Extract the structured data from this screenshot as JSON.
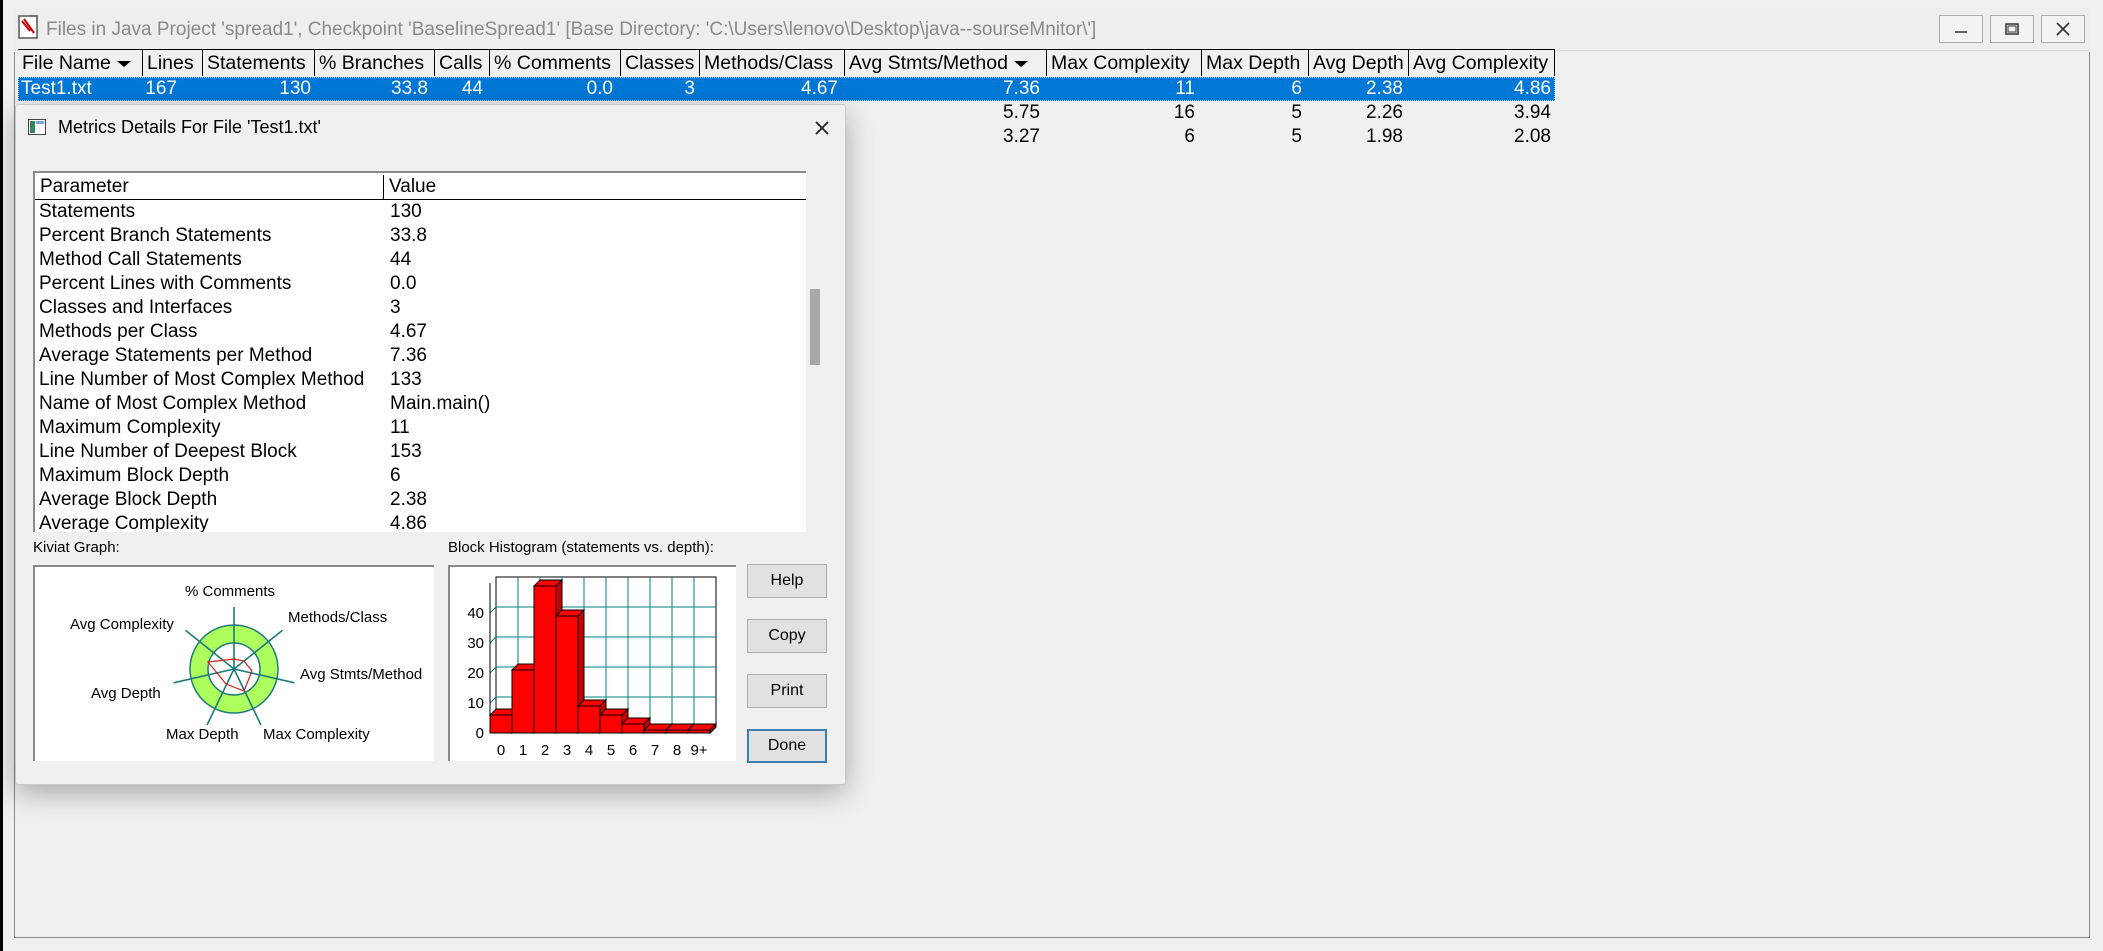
{
  "window": {
    "title": "Files in Java Project 'spread1', Checkpoint 'BaselineSpread1'  [Base Directory: 'C:\\Users\\lenovo\\Desktop\\java--sourseMnitor\\']"
  },
  "table": {
    "columns": [
      "File Name",
      "Lines",
      "Statements",
      "% Branches",
      "Calls",
      "% Comments",
      "Classes",
      "Methods/Class",
      "Avg Stmts/Method",
      "Max Complexity",
      "Max Depth",
      "Avg Depth",
      "Avg Complexity"
    ],
    "rows": [
      {
        "file": "Test1.txt",
        "lines": "167",
        "statements": "130",
        "branches": "33.8",
        "calls": "44",
        "comments": "0.0",
        "classes": "3",
        "methods_class": "4.67",
        "avg_stmts": "7.36",
        "max_complexity": "11",
        "max_depth": "6",
        "avg_depth": "2.38",
        "avg_complexity": "4.86"
      },
      {
        "avg_stmts": "5.75",
        "max_complexity": "16",
        "max_depth": "5",
        "avg_depth": "2.26",
        "avg_complexity": "3.94"
      },
      {
        "avg_stmts": "3.27",
        "max_complexity": "6",
        "max_depth": "5",
        "avg_depth": "1.98",
        "avg_complexity": "2.08"
      }
    ]
  },
  "dialog": {
    "title": "Metrics Details For File 'Test1.txt'",
    "param_header": "Parameter",
    "value_header": "Value",
    "params": [
      {
        "name": "Statements",
        "value": "130"
      },
      {
        "name": "Percent Branch Statements",
        "value": "33.8"
      },
      {
        "name": "Method Call Statements",
        "value": "44"
      },
      {
        "name": "Percent Lines with Comments",
        "value": "0.0"
      },
      {
        "name": "Classes and Interfaces",
        "value": "3"
      },
      {
        "name": "Methods per Class",
        "value": "4.67"
      },
      {
        "name": "Average Statements per Method",
        "value": "7.36"
      },
      {
        "name": "Line Number of Most Complex Method",
        "value": "133"
      },
      {
        "name": "Name of Most Complex Method",
        "value": "Main.main()"
      },
      {
        "name": "Maximum Complexity",
        "value": "11"
      },
      {
        "name": "Line Number of Deepest Block",
        "value": "153"
      },
      {
        "name": "Maximum Block Depth",
        "value": "6"
      },
      {
        "name": "Average Block Depth",
        "value": "2.38"
      },
      {
        "name": "Average Complexity",
        "value": "4.86"
      }
    ],
    "kiviat_caption": "Kiviat Graph:",
    "histogram_caption": "Block Histogram (statements vs. depth):",
    "kiviat_axes": [
      "% Comments",
      "Methods/Class",
      "Avg Stmts/Method",
      "Max Complexity",
      "Max Depth",
      "Avg Depth",
      "Avg Complexity"
    ],
    "buttons": {
      "help": "Help",
      "copy": "Copy",
      "print": "Print",
      "done": "Done"
    }
  },
  "chart_data": {
    "type": "bar",
    "categories": [
      "0",
      "1",
      "2",
      "3",
      "4",
      "5",
      "6",
      "7",
      "8",
      "9+"
    ],
    "values": [
      6,
      21,
      49,
      39,
      9,
      6,
      3,
      1,
      1,
      1
    ],
    "ylim": [
      0,
      50
    ],
    "yticks": [
      "0",
      "10",
      "20",
      "30",
      "40"
    ],
    "colors": {
      "bar": "#ff0000",
      "grid": "#008080"
    }
  },
  "colors": {
    "selection": "#0078d7",
    "kiviat_fill": "#adff5e"
  }
}
